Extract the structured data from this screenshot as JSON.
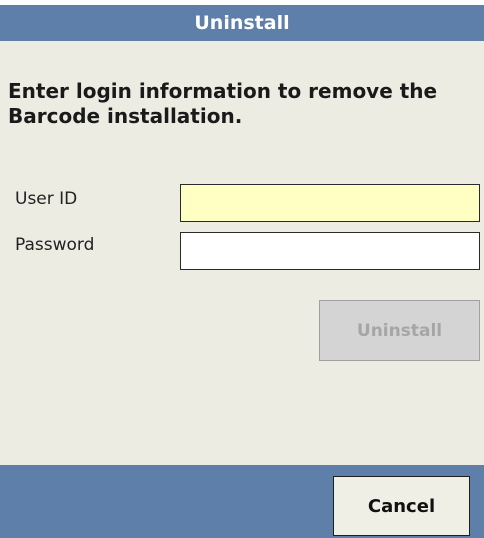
{
  "dialog": {
    "title": "Uninstall",
    "instruction_line1": "Enter login information to remove the",
    "instruction_line2": "Barcode installation."
  },
  "form": {
    "user_id_label": "User ID",
    "user_id_value": "",
    "password_label": "Password",
    "password_value": ""
  },
  "actions": {
    "uninstall_label": "Uninstall",
    "uninstall_enabled": false,
    "cancel_label": "Cancel"
  },
  "colors": {
    "header_bar": "#5e7fa9",
    "content_background": "#ecece2",
    "user_id_field_background": "#ffffc4",
    "disabled_button_text": "#a6a6a6"
  }
}
